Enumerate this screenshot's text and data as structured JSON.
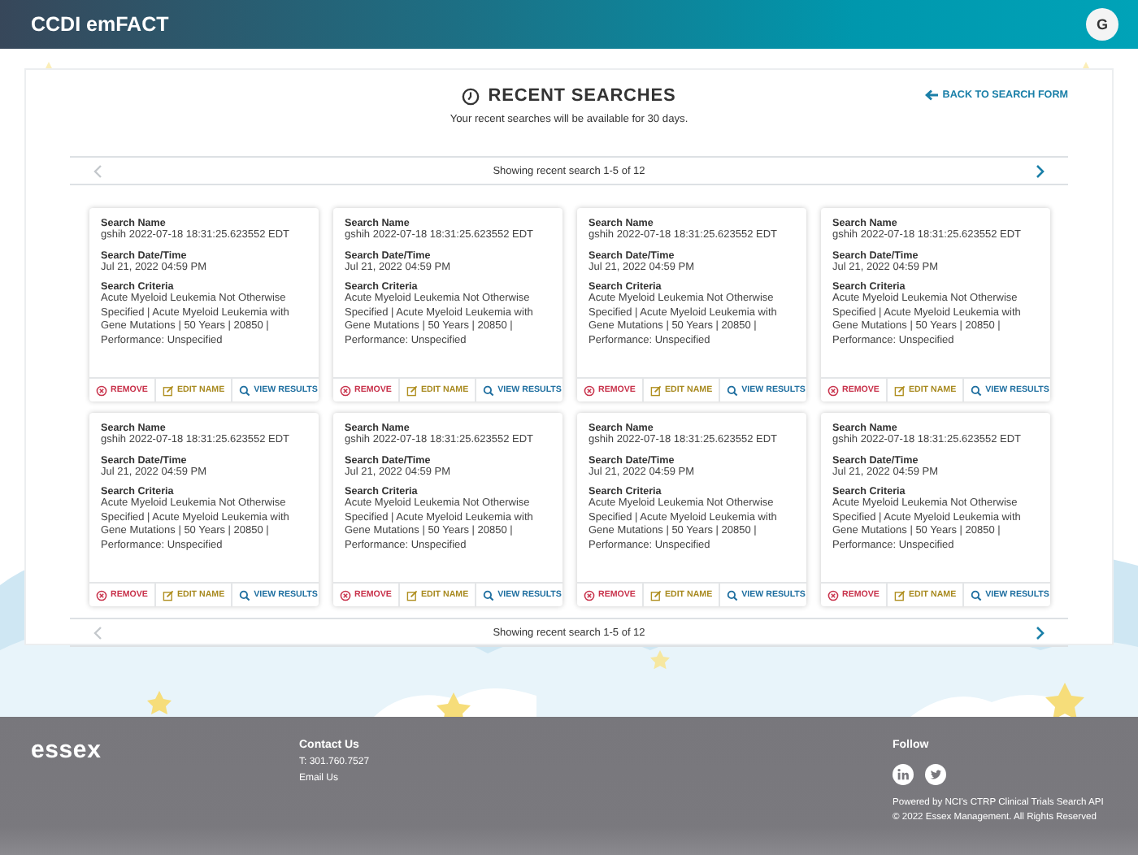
{
  "header": {
    "title": "CCDI emFACT",
    "avatar": "G"
  },
  "page": {
    "title": "RECENT SEARCHES",
    "subtitle": "Your recent searches will be available for 30 days.",
    "back_link": "BACK TO SEARCH FORM"
  },
  "pager_top": {
    "text": "Showing recent search 1-5 of 12",
    "prev_disabled": true,
    "next_disabled": false
  },
  "cards": [
    {
      "fields": [
        {
          "label": "Search Name",
          "value": "gshih 2022-07-18 18:31:25.623552 EDT"
        },
        {
          "label": "Search Date/Time",
          "value": "Jul 21, 2022 04:59 PM"
        },
        {
          "label": "Search Criteria",
          "value": "Acute Myeloid Leukemia Not Otherwise Specified | Acute Myeloid Leukemia with Gene Mutations | 50 Years | 20850 | Performance: Unspecified"
        }
      ],
      "actions": [
        {
          "kind": "remove",
          "label": "REMOVE"
        },
        {
          "kind": "edit",
          "label": "EDIT NAME"
        },
        {
          "kind": "view",
          "label": "VIEW RESULTS"
        }
      ]
    },
    {
      "fields": [
        {
          "label": "Search Name",
          "value": "gshih 2022-07-18 18:31:25.623552 EDT"
        },
        {
          "label": "Search Date/Time",
          "value": "Jul 21, 2022 04:59 PM"
        },
        {
          "label": "Search Criteria",
          "value": "Acute Myeloid Leukemia Not Otherwise Specified | Acute Myeloid Leukemia with Gene Mutations | 50 Years | 20850 | Performance: Unspecified"
        }
      ],
      "actions": [
        {
          "kind": "remove",
          "label": "REMOVE"
        },
        {
          "kind": "edit",
          "label": "EDIT NAME"
        },
        {
          "kind": "view",
          "label": "VIEW RESULTS"
        }
      ]
    },
    {
      "fields": [
        {
          "label": "Search Name",
          "value": "gshih 2022-07-18 18:31:25.623552 EDT"
        },
        {
          "label": "Search Date/Time",
          "value": "Jul 21, 2022 04:59 PM"
        },
        {
          "label": "Search Criteria",
          "value": "Acute Myeloid Leukemia Not Otherwise Specified | Acute Myeloid Leukemia with Gene Mutations | 50 Years | 20850 | Performance: Unspecified"
        }
      ],
      "actions": [
        {
          "kind": "remove",
          "label": "REMOVE"
        },
        {
          "kind": "edit",
          "label": "EDIT NAME"
        },
        {
          "kind": "view",
          "label": "VIEW RESULTS"
        }
      ]
    },
    {
      "fields": [
        {
          "label": "Search Name",
          "value": "gshih 2022-07-18 18:31:25.623552 EDT"
        },
        {
          "label": "Search Date/Time",
          "value": "Jul 21, 2022 04:59 PM"
        },
        {
          "label": "Search Criteria",
          "value": "Acute Myeloid Leukemia Not Otherwise Specified | Acute Myeloid Leukemia with Gene Mutations | 50 Years | 20850 | Performance: Unspecified"
        }
      ],
      "actions": [
        {
          "kind": "remove",
          "label": "REMOVE"
        },
        {
          "kind": "edit",
          "label": "EDIT NAME"
        },
        {
          "kind": "view",
          "label": "VIEW RESULTS"
        }
      ]
    },
    {
      "fields": [
        {
          "label": "Search Name",
          "value": "gshih 2022-07-18 18:31:25.623552 EDT"
        },
        {
          "label": "Search Date/Time",
          "value": "Jul 21, 2022 04:59 PM"
        },
        {
          "label": "Search Criteria",
          "value": "Acute Myeloid Leukemia Not Otherwise Specified | Acute Myeloid Leukemia with Gene Mutations | 50 Years | 20850 | Performance: Unspecified"
        }
      ],
      "actions": [
        {
          "kind": "remove",
          "label": "REMOVE"
        },
        {
          "kind": "edit",
          "label": "EDIT NAME"
        },
        {
          "kind": "view",
          "label": "VIEW RESULTS"
        }
      ]
    },
    {
      "fields": [
        {
          "label": "Search Name",
          "value": "gshih 2022-07-18 18:31:25.623552 EDT"
        },
        {
          "label": "Search Date/Time",
          "value": "Jul 21, 2022 04:59 PM"
        },
        {
          "label": "Search Criteria",
          "value": "Acute Myeloid Leukemia Not Otherwise Specified | Acute Myeloid Leukemia with Gene Mutations | 50 Years | 20850 | Performance: Unspecified"
        }
      ],
      "actions": [
        {
          "kind": "remove",
          "label": "REMOVE"
        },
        {
          "kind": "edit",
          "label": "EDIT NAME"
        },
        {
          "kind": "view",
          "label": "VIEW RESULTS"
        }
      ]
    },
    {
      "fields": [
        {
          "label": "Search Name",
          "value": "gshih 2022-07-18 18:31:25.623552 EDT"
        },
        {
          "label": "Search Date/Time",
          "value": "Jul 21, 2022 04:59 PM"
        },
        {
          "label": "Search Criteria",
          "value": "Acute Myeloid Leukemia Not Otherwise Specified | Acute Myeloid Leukemia with Gene Mutations | 50 Years | 20850 | Performance: Unspecified"
        }
      ],
      "actions": [
        {
          "kind": "remove",
          "label": "REMOVE"
        },
        {
          "kind": "edit",
          "label": "EDIT NAME"
        },
        {
          "kind": "view",
          "label": "VIEW RESULTS"
        }
      ]
    },
    {
      "fields": [
        {
          "label": "Search Name",
          "value": "gshih 2022-07-18 18:31:25.623552 EDT"
        },
        {
          "label": "Search Date/Time",
          "value": "Jul 21, 2022 04:59 PM"
        },
        {
          "label": "Search Criteria",
          "value": "Acute Myeloid Leukemia Not Otherwise Specified | Acute Myeloid Leukemia with Gene Mutations | 50 Years | 20850 | Performance: Unspecified"
        }
      ],
      "actions": [
        {
          "kind": "remove",
          "label": "REMOVE"
        },
        {
          "kind": "edit",
          "label": "EDIT NAME"
        },
        {
          "kind": "view",
          "label": "VIEW RESULTS"
        }
      ]
    }
  ],
  "pager_bottom": {
    "text": "Showing recent search 1-5 of 12",
    "prev_disabled": true,
    "next_disabled": false
  },
  "footer": {
    "logo": "essex",
    "contact_title": "Contact Us",
    "contact_lines": [
      "T: 301.760.7527",
      "Email Us"
    ],
    "follow_title": "Follow",
    "social": [
      {
        "kind": "linkedin"
      },
      {
        "kind": "twitter"
      }
    ],
    "notes": [
      "Powered by NCI's CTRP Clinical Trials Search API",
      "© 2022 Essex Management. All Rights Reserved"
    ]
  }
}
